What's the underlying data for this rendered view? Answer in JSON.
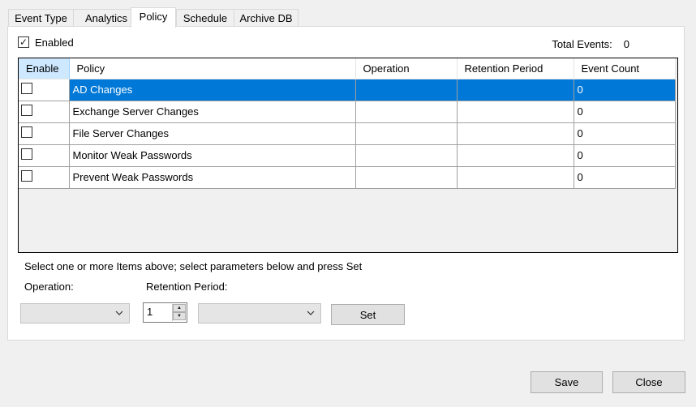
{
  "tabs": [
    "Event Type",
    "Analytics",
    "Policy",
    "Schedule",
    "Archive DB"
  ],
  "active_tab": "Policy",
  "enabled": {
    "label": "Enabled",
    "checked": true
  },
  "total_events": {
    "label": "Total Events:",
    "value": "0"
  },
  "grid": {
    "columns": [
      "Enable",
      "Policy",
      "Operation",
      "Retention Period",
      "Event Count"
    ],
    "rows": [
      {
        "policy": "AD Changes",
        "operation": "",
        "retention": "",
        "count": "0",
        "selected": true
      },
      {
        "policy": "Exchange Server Changes",
        "operation": "",
        "retention": "",
        "count": "0"
      },
      {
        "policy": "File Server Changes",
        "operation": "",
        "retention": "",
        "count": "0"
      },
      {
        "policy": "Monitor Weak Passwords",
        "operation": "",
        "retention": "",
        "count": "0"
      },
      {
        "policy": "Prevent Weak Passwords",
        "operation": "",
        "retention": "",
        "count": "0"
      }
    ]
  },
  "hint": "Select one or more Items above; select parameters below and press Set",
  "operation_label": "Operation:",
  "retention_label": "Retention Period:",
  "retention_value": "1",
  "set_label": "Set",
  "save_label": "Save",
  "close_label": "Close",
  "colors": {
    "selection": "#0078d7",
    "header_selected": "#cde8ff"
  }
}
